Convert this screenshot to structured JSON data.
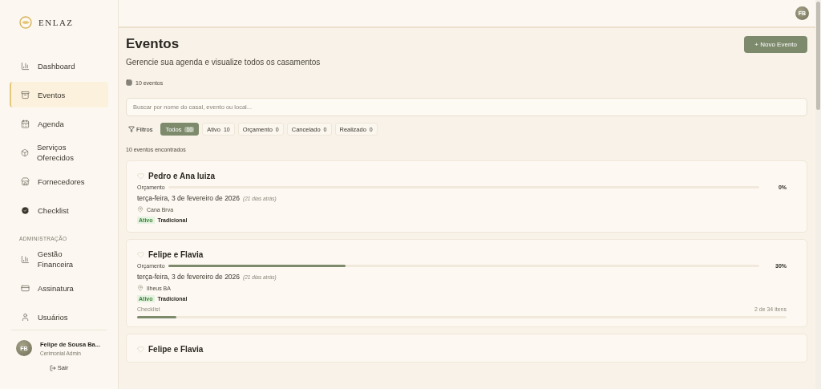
{
  "brand": "ENLAZ",
  "nav": [
    {
      "label": "Dashboard",
      "selected": false
    },
    {
      "label": "Eventos",
      "selected": true
    },
    {
      "label": "Agenda",
      "selected": false
    },
    {
      "label": "Serviços Oferecidos",
      "selected": false
    },
    {
      "label": "Fornecedores",
      "selected": false
    },
    {
      "label": "Checklist",
      "selected": false
    }
  ],
  "admin_section": {
    "title": "ADMINISTRAÇÃO",
    "items": [
      {
        "label": "Gestão Financeira",
        "selected": false
      },
      {
        "label": "Assinatura",
        "selected": false
      },
      {
        "label": "Usuários",
        "selected": false
      }
    ]
  },
  "user": {
    "initials": "FB",
    "name": "Felipe de Sousa Ba...",
    "role": "Cerimonial Admin",
    "logout": "Sair"
  },
  "header": {
    "avatar": "FB"
  },
  "page": {
    "title": "Eventos",
    "subtitle": "Gerencie sua agenda e visualize todos os casamentos",
    "count": "10 eventos",
    "new_button": "+ Novo Evento"
  },
  "search": {
    "placeholder": "Buscar por nome do casal, evento ou local..."
  },
  "filters": {
    "label": "Filtros",
    "chips": [
      {
        "label": "Todos",
        "count": "10",
        "selected": true
      },
      {
        "label": "Ativo",
        "count": "10",
        "selected": false
      },
      {
        "label": "Orçamento",
        "count": "0",
        "selected": false
      },
      {
        "label": "Cancelado",
        "count": "0",
        "selected": false
      },
      {
        "label": "Realizado",
        "count": "0",
        "selected": false
      }
    ]
  },
  "results": "10 eventos encontrados",
  "events": [
    {
      "name": "Pedro e Ana luiza",
      "budget_label": "Orçamento",
      "level": 0,
      "percent": "0%",
      "date": "terça-feira, 3 de fevereiro de 2026",
      "relative": "(21 dias atrás)",
      "location": "Cana Brva",
      "status": "Ativo",
      "type": "Tradicional"
    },
    {
      "name": "Felipe e Flavia",
      "budget_label": "Orçamento",
      "level": 0.3,
      "percent": "30%",
      "date": "terça-feira, 3 de fevereiro de 2026",
      "relative": "(21 dias atrás)",
      "location": "Ilheus  BA",
      "status": "Ativo",
      "type": "Tradicional",
      "checklist": {
        "label": "Checklist",
        "count": "2 de 34 itens",
        "level": 0.06
      }
    },
    {
      "name": "Felipe e Flavia"
    }
  ]
}
